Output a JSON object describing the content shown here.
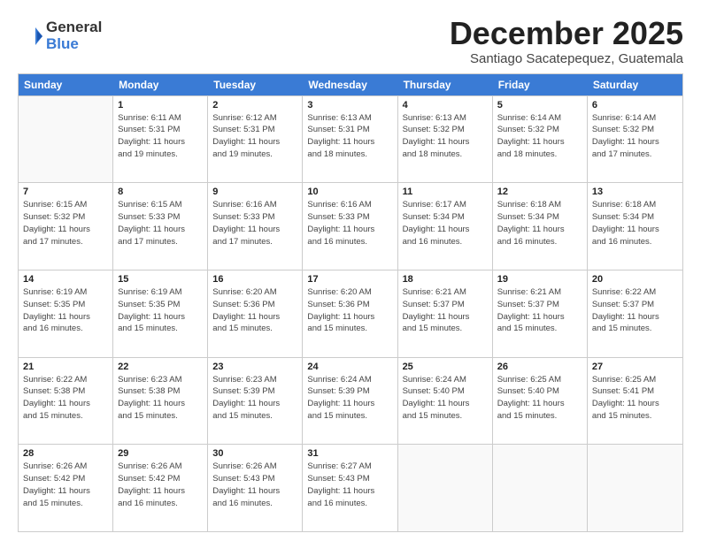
{
  "logo": {
    "general": "General",
    "blue": "Blue"
  },
  "title": "December 2025",
  "subtitle": "Santiago Sacatepequez, Guatemala",
  "header_days": [
    "Sunday",
    "Monday",
    "Tuesday",
    "Wednesday",
    "Thursday",
    "Friday",
    "Saturday"
  ],
  "weeks": [
    [
      {
        "day": "",
        "info": ""
      },
      {
        "day": "1",
        "info": "Sunrise: 6:11 AM\nSunset: 5:31 PM\nDaylight: 11 hours\nand 19 minutes."
      },
      {
        "day": "2",
        "info": "Sunrise: 6:12 AM\nSunset: 5:31 PM\nDaylight: 11 hours\nand 19 minutes."
      },
      {
        "day": "3",
        "info": "Sunrise: 6:13 AM\nSunset: 5:31 PM\nDaylight: 11 hours\nand 18 minutes."
      },
      {
        "day": "4",
        "info": "Sunrise: 6:13 AM\nSunset: 5:32 PM\nDaylight: 11 hours\nand 18 minutes."
      },
      {
        "day": "5",
        "info": "Sunrise: 6:14 AM\nSunset: 5:32 PM\nDaylight: 11 hours\nand 18 minutes."
      },
      {
        "day": "6",
        "info": "Sunrise: 6:14 AM\nSunset: 5:32 PM\nDaylight: 11 hours\nand 17 minutes."
      }
    ],
    [
      {
        "day": "7",
        "info": "Sunrise: 6:15 AM\nSunset: 5:32 PM\nDaylight: 11 hours\nand 17 minutes."
      },
      {
        "day": "8",
        "info": "Sunrise: 6:15 AM\nSunset: 5:33 PM\nDaylight: 11 hours\nand 17 minutes."
      },
      {
        "day": "9",
        "info": "Sunrise: 6:16 AM\nSunset: 5:33 PM\nDaylight: 11 hours\nand 17 minutes."
      },
      {
        "day": "10",
        "info": "Sunrise: 6:16 AM\nSunset: 5:33 PM\nDaylight: 11 hours\nand 16 minutes."
      },
      {
        "day": "11",
        "info": "Sunrise: 6:17 AM\nSunset: 5:34 PM\nDaylight: 11 hours\nand 16 minutes."
      },
      {
        "day": "12",
        "info": "Sunrise: 6:18 AM\nSunset: 5:34 PM\nDaylight: 11 hours\nand 16 minutes."
      },
      {
        "day": "13",
        "info": "Sunrise: 6:18 AM\nSunset: 5:34 PM\nDaylight: 11 hours\nand 16 minutes."
      }
    ],
    [
      {
        "day": "14",
        "info": "Sunrise: 6:19 AM\nSunset: 5:35 PM\nDaylight: 11 hours\nand 16 minutes."
      },
      {
        "day": "15",
        "info": "Sunrise: 6:19 AM\nSunset: 5:35 PM\nDaylight: 11 hours\nand 15 minutes."
      },
      {
        "day": "16",
        "info": "Sunrise: 6:20 AM\nSunset: 5:36 PM\nDaylight: 11 hours\nand 15 minutes."
      },
      {
        "day": "17",
        "info": "Sunrise: 6:20 AM\nSunset: 5:36 PM\nDaylight: 11 hours\nand 15 minutes."
      },
      {
        "day": "18",
        "info": "Sunrise: 6:21 AM\nSunset: 5:37 PM\nDaylight: 11 hours\nand 15 minutes."
      },
      {
        "day": "19",
        "info": "Sunrise: 6:21 AM\nSunset: 5:37 PM\nDaylight: 11 hours\nand 15 minutes."
      },
      {
        "day": "20",
        "info": "Sunrise: 6:22 AM\nSunset: 5:37 PM\nDaylight: 11 hours\nand 15 minutes."
      }
    ],
    [
      {
        "day": "21",
        "info": "Sunrise: 6:22 AM\nSunset: 5:38 PM\nDaylight: 11 hours\nand 15 minutes."
      },
      {
        "day": "22",
        "info": "Sunrise: 6:23 AM\nSunset: 5:38 PM\nDaylight: 11 hours\nand 15 minutes."
      },
      {
        "day": "23",
        "info": "Sunrise: 6:23 AM\nSunset: 5:39 PM\nDaylight: 11 hours\nand 15 minutes."
      },
      {
        "day": "24",
        "info": "Sunrise: 6:24 AM\nSunset: 5:39 PM\nDaylight: 11 hours\nand 15 minutes."
      },
      {
        "day": "25",
        "info": "Sunrise: 6:24 AM\nSunset: 5:40 PM\nDaylight: 11 hours\nand 15 minutes."
      },
      {
        "day": "26",
        "info": "Sunrise: 6:25 AM\nSunset: 5:40 PM\nDaylight: 11 hours\nand 15 minutes."
      },
      {
        "day": "27",
        "info": "Sunrise: 6:25 AM\nSunset: 5:41 PM\nDaylight: 11 hours\nand 15 minutes."
      }
    ],
    [
      {
        "day": "28",
        "info": "Sunrise: 6:26 AM\nSunset: 5:42 PM\nDaylight: 11 hours\nand 15 minutes."
      },
      {
        "day": "29",
        "info": "Sunrise: 6:26 AM\nSunset: 5:42 PM\nDaylight: 11 hours\nand 16 minutes."
      },
      {
        "day": "30",
        "info": "Sunrise: 6:26 AM\nSunset: 5:43 PM\nDaylight: 11 hours\nand 16 minutes."
      },
      {
        "day": "31",
        "info": "Sunrise: 6:27 AM\nSunset: 5:43 PM\nDaylight: 11 hours\nand 16 minutes."
      },
      {
        "day": "",
        "info": ""
      },
      {
        "day": "",
        "info": ""
      },
      {
        "day": "",
        "info": ""
      }
    ]
  ]
}
